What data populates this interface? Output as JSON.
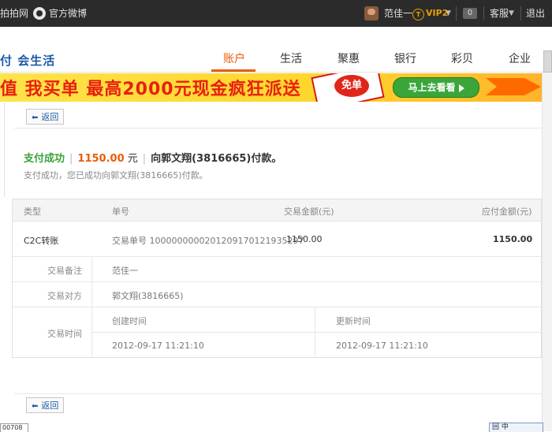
{
  "topbar": {
    "left_fragment": "拍拍网",
    "weibo_label": "官方微博",
    "username": "范佳一",
    "vip_badge": "T",
    "vip_text": "VIP2",
    "message_count": "0",
    "service_label": "客服",
    "logout_label": "退出"
  },
  "header": {
    "logo_text": "付 会生活",
    "nav": [
      "账户",
      "生活",
      "聚惠",
      "银行",
      "彩贝",
      "企业"
    ],
    "active_nav": "账户"
  },
  "banner": {
    "headline_1": "值 我买单",
    "headline_2": "最高2000元现金疯狂派送",
    "seal_text": "免单",
    "cta_label": "马上去看看"
  },
  "actions": {
    "back_label": "返回"
  },
  "result": {
    "status": "支付成功",
    "amount": "1150.00",
    "unit": "元",
    "payee_text": "向郭文翔(3816665)付款。",
    "subtitle": "支付成功，您已成功向郭文翔(3816665)付款。"
  },
  "table": {
    "headers": {
      "type": "类型",
      "order_no": "单号",
      "trade_amount": "交易金额(元)",
      "due_amount": "应付金额(元)"
    },
    "row": {
      "type": "C2C转账",
      "order_no": "交易单号 10000000002012091701219352​97",
      "trade_amount": "1150.00",
      "due_amount": "1150.00"
    },
    "details": {
      "note_label": "交易备注",
      "note_value": "范佳一",
      "counterparty_label": "交易对方",
      "counterparty_value": "郭文翔(3816665)",
      "time_label": "交易时间",
      "created_label": "创建时间",
      "updated_label": "更新时间",
      "created_value": "2012-09-17 11:21:10",
      "updated_value": "2012-09-17 11:21:10"
    }
  },
  "footer": {
    "status_fragment": "00708",
    "corner_widget_text": "回 中"
  },
  "colors": {
    "accent": "#ea5c0b",
    "success": "#3aa23a",
    "link": "#1b5ea7",
    "topbar": "#2b2b2b"
  }
}
